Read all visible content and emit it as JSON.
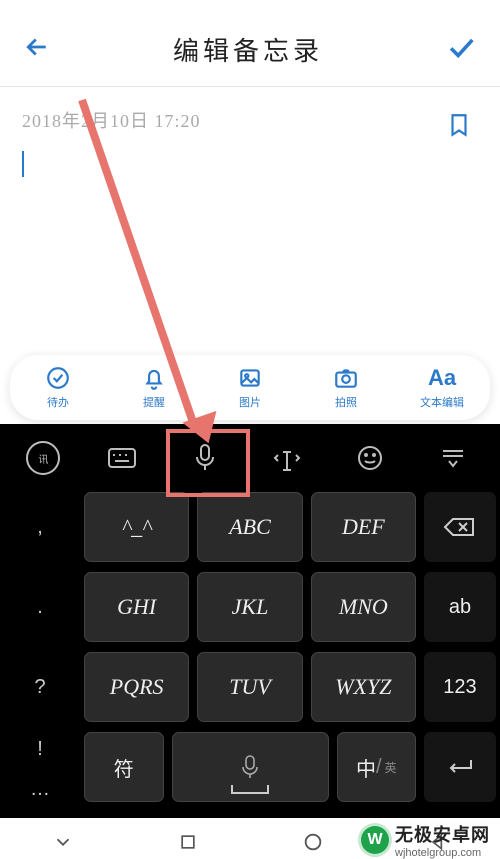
{
  "header": {
    "title": "编辑备忘录"
  },
  "content": {
    "datetime": "2018年2月10日  17:20"
  },
  "toolbar": {
    "todo": "待办",
    "remind": "提醒",
    "image": "图片",
    "camera": "拍照",
    "text_edit": "文本编辑"
  },
  "keys": {
    "r1": {
      "k1": "^_^",
      "k2": "ABC",
      "k3": "DEF"
    },
    "r2": {
      "p": ".",
      "k1": "GHI",
      "k2": "JKL",
      "k3": "MNO",
      "side": "ab"
    },
    "r3": {
      "p": "?",
      "k1": "PQRS",
      "k2": "TUV",
      "k3": "WXYZ",
      "side": "123"
    },
    "r4": {
      "p": "!",
      "k1": "符",
      "zh": "中",
      "en": "英"
    },
    "r5": {
      "p": "…"
    },
    "punct1": ","
  },
  "watermark": {
    "name": "无极安卓网",
    "url": "wjhotelgroup.com",
    "logo": "W"
  }
}
